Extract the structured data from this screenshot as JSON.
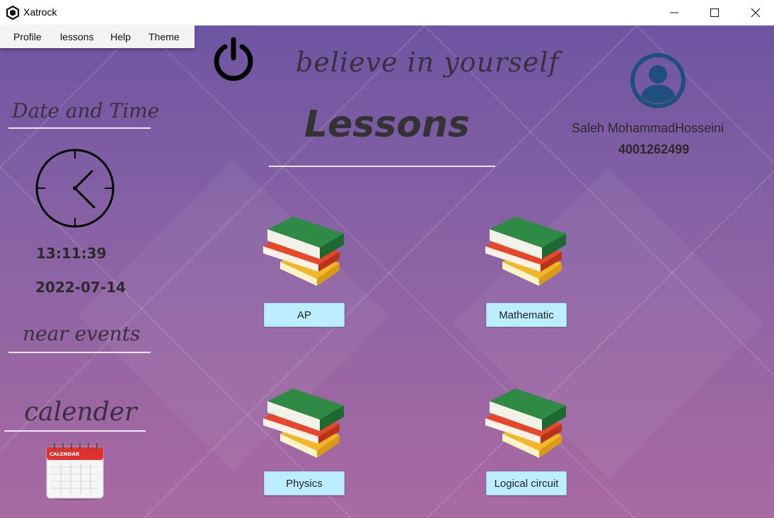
{
  "window": {
    "title": "Xatrock"
  },
  "menu": {
    "items": [
      "Profile",
      "lessons",
      "Help",
      "Theme"
    ]
  },
  "motto": "believe in yourself",
  "page_title": "Lessons",
  "sidebar": {
    "date_time_heading": "Date and Time",
    "time": "13:11:39",
    "date": "2022-07-14",
    "events_heading": "near events",
    "calendar_heading": "calender",
    "calendar_icon_text": "CALENDAR"
  },
  "user": {
    "name": "Saleh MohammadHosseini",
    "id": "4001262499"
  },
  "lessons": [
    "AP",
    "Mathematic",
    "Physics",
    "Logical circuit"
  ],
  "colors": {
    "bg_top": "#6e55a2",
    "bg_bottom": "#a96aa2",
    "button": "#bdeeff",
    "avatar": "#1f4f7d"
  },
  "icons": [
    "app-logo-icon",
    "power-icon",
    "clock-icon",
    "calendar-icon",
    "user-avatar-icon",
    "books-icon"
  ]
}
